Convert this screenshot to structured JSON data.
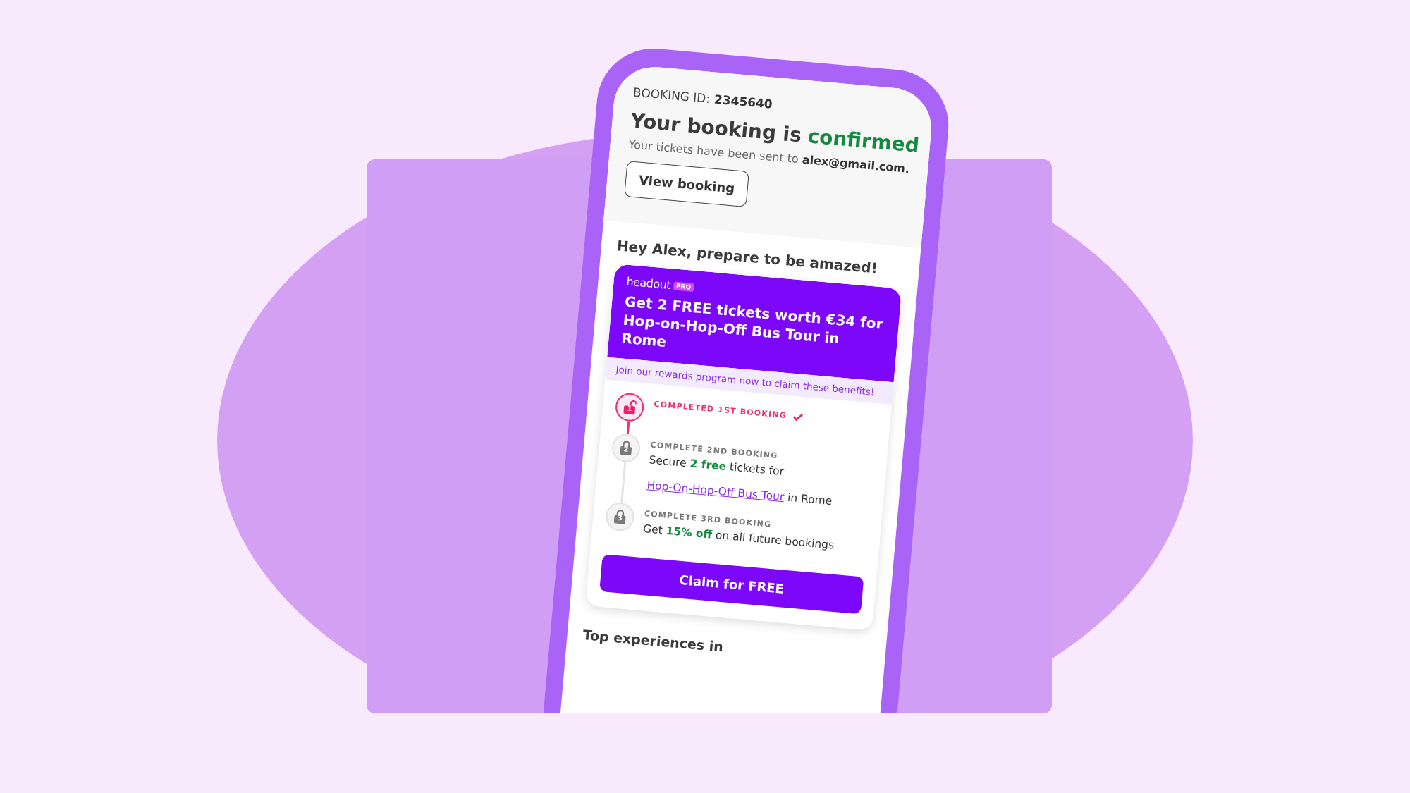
{
  "booking": {
    "id_label": "BOOKING ID:",
    "id_value": "2345640",
    "title": "Your booking is",
    "status": "confirmed",
    "sent_text": "Your tickets have been sent to **alex@gmail.com.**",
    "button": "View booking"
  },
  "greeting": "Hey Alex, prepare to be amazed!",
  "promo": {
    "brand": "headout",
    "badge": "PRO",
    "headline": "Get **2 FREE** tickets worth €34 for Hop-on-Hop-Off Bus Tour in Rome",
    "subline": "Join our rewards program now to claim these benefits!",
    "steps": [
      {
        "number": "1",
        "label": "COMPLETED 1ST BOOKING",
        "completed": true
      },
      {
        "number": "2",
        "label": "COMPLETE 2ND BOOKING",
        "completed": false,
        "description": [
          {
            "kind": "text",
            "text": "Secure"
          },
          {
            "kind": "highlight",
            "text": "2 free"
          },
          {
            "kind": "text",
            "text": "tickets for"
          },
          {
            "kind": "link",
            "text": "Hop-On-Hop-Off Bus Tour"
          },
          {
            "kind": "text",
            "text": "in Rome"
          }
        ]
      },
      {
        "number": "3",
        "label": "COMPLETE 3RD BOOKING",
        "completed": false,
        "description": [
          {
            "kind": "text",
            "text": "Get"
          },
          {
            "kind": "highlight",
            "text": "15% off"
          },
          {
            "kind": "text",
            "text": "on all future bookings"
          }
        ]
      }
    ],
    "button": "Claim for FREE"
  },
  "next_section": "Top experiences in"
}
